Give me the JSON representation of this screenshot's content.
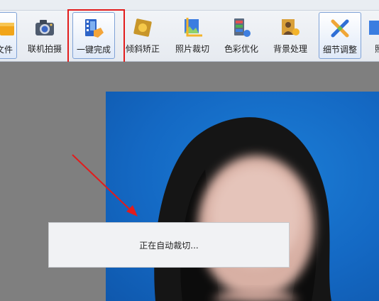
{
  "toolbar": {
    "items": [
      {
        "label": "文件",
        "icon": "folder-icon"
      },
      {
        "label": "联机拍摄",
        "icon": "camera-icon"
      },
      {
        "label": "一键完成",
        "icon": "one-click-icon"
      },
      {
        "label": "倾斜矫正",
        "icon": "tilt-correct-icon"
      },
      {
        "label": "照片裁切",
        "icon": "crop-icon"
      },
      {
        "label": "色彩优化",
        "icon": "color-optimize-icon"
      },
      {
        "label": "背景处理",
        "icon": "background-icon"
      },
      {
        "label": "细节调整",
        "icon": "detail-adjust-icon"
      },
      {
        "label": "照",
        "icon": "photo-icon"
      }
    ]
  },
  "dialog": {
    "message": "正在自动裁切..."
  },
  "colors": {
    "highlight": "#e21c1c",
    "photo_background": "#1469c4",
    "workspace": "#7f7f7f"
  }
}
